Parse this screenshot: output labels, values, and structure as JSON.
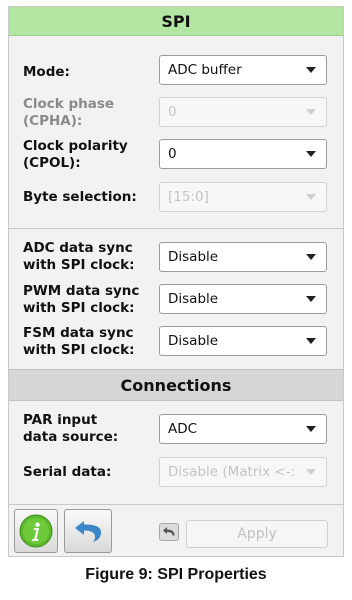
{
  "panel": {
    "title": "SPI",
    "connections_title": "Connections"
  },
  "fields": {
    "mode": {
      "label": "Mode:",
      "value": "ADC buffer"
    },
    "cpha": {
      "label_line1": "Clock phase",
      "label_line2": "(CPHA):",
      "value": "0"
    },
    "cpol": {
      "label_line1": "Clock polarity",
      "label_line2": "(CPOL):",
      "value": "0"
    },
    "byte_selection": {
      "label": "Byte selection:",
      "value": "[15:0]"
    },
    "adc_sync": {
      "label_line1": "ADC data sync",
      "label_line2": "with SPI clock:",
      "value": "Disable"
    },
    "pwm_sync": {
      "label_line1": "PWM data sync",
      "label_line2": "with SPI clock:",
      "value": "Disable"
    },
    "fsm_sync": {
      "label_line1": "FSM data sync",
      "label_line2": "with SPI clock:",
      "value": "Disable"
    },
    "par_input": {
      "label_line1": "PAR input",
      "label_line2": "data source:",
      "value": "ADC"
    },
    "serial_data": {
      "label": "Serial data:",
      "value": "Disable (Matrix <-:"
    }
  },
  "footer": {
    "apply_label": "Apply"
  },
  "caption": "Figure 9: SPI Properties",
  "colors": {
    "header_green": "#b3e6a3",
    "header_gray": "#d6d6d6",
    "info_green": "#5cb82e",
    "undo_blue": "#3a86c8"
  },
  "icons": [
    "info-icon",
    "undo-icon",
    "small-undo-icon",
    "dropdown-arrow-icon"
  ]
}
